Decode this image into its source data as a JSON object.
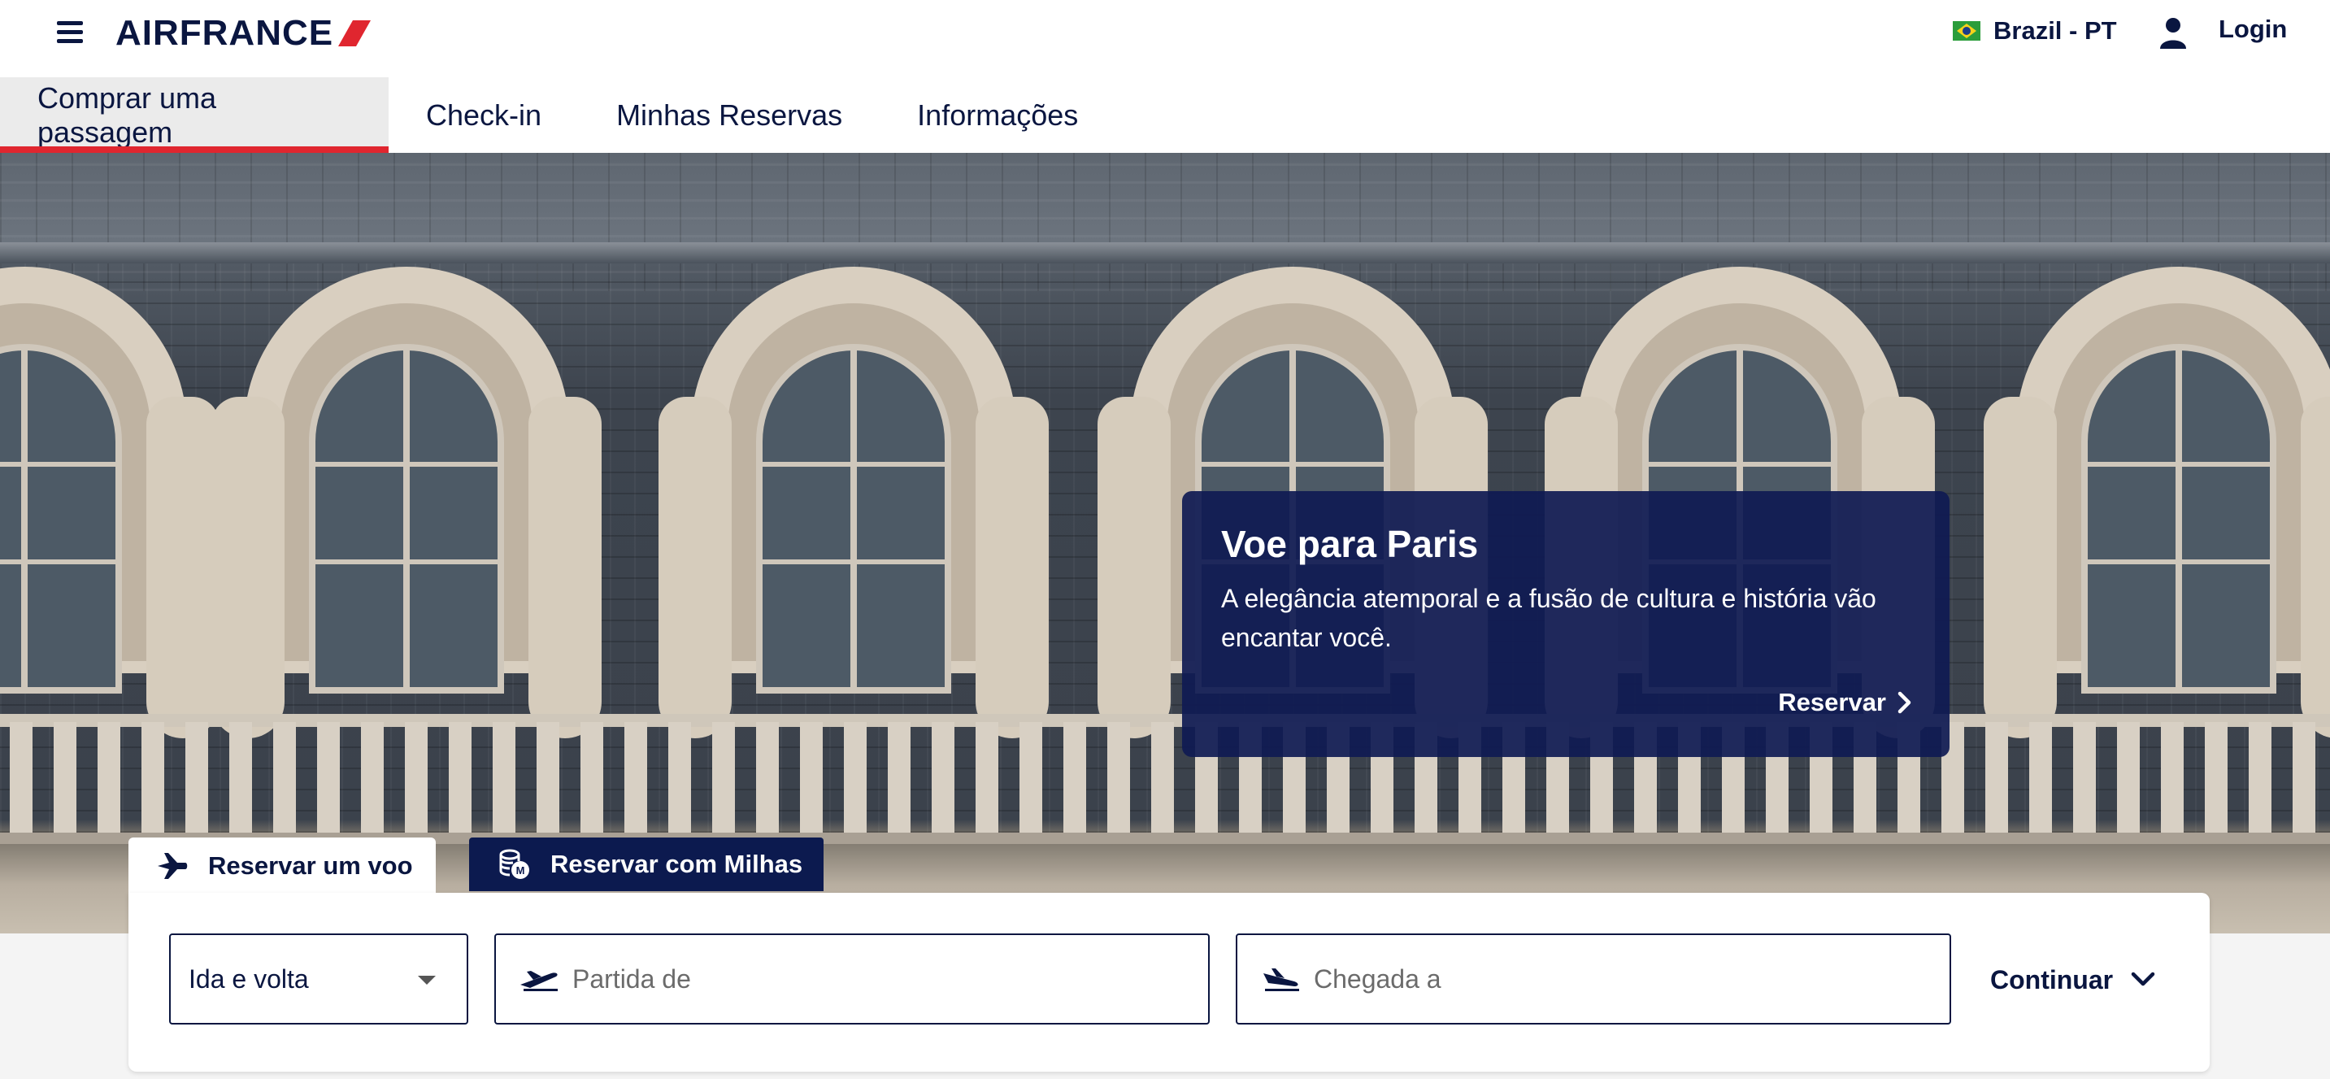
{
  "header": {
    "logo_text": "AIRFRANCE",
    "language": "Brazil - PT",
    "login_label": "Login",
    "brand_color": "#0a1640",
    "accent_color": "#e0262f"
  },
  "nav": {
    "items": [
      {
        "label": "Comprar uma passagem",
        "active": true
      },
      {
        "label": "Check-in",
        "active": false
      },
      {
        "label": "Minhas Reservas",
        "active": false
      },
      {
        "label": "Informações",
        "active": false
      }
    ]
  },
  "promo": {
    "title": "Voe para Paris",
    "text": "A elegância atemporal e a fusão de cultura e história vão encantar você.",
    "cta_label": "Reservar"
  },
  "booking": {
    "tabs": [
      {
        "label": "Reservar um voo",
        "icon": "airplane-icon",
        "active": true
      },
      {
        "label": "Reservar com Milhas",
        "icon": "miles-coins-icon",
        "active": false
      }
    ],
    "trip_type": "Ida e volta",
    "origin_placeholder": "Partida de",
    "destination_placeholder": "Chegada a",
    "continue_label": "Continuar"
  }
}
